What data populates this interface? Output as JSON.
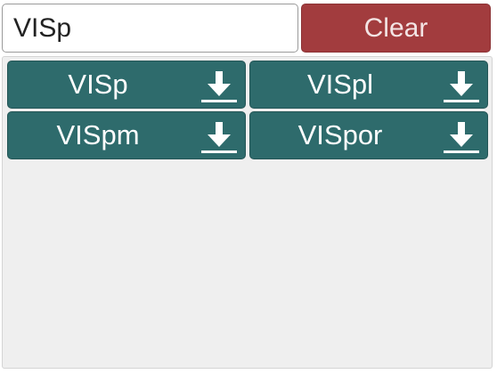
{
  "search": {
    "value": "VISp",
    "placeholder": ""
  },
  "clear_button": {
    "label": "Clear",
    "color": "#a23c3e"
  },
  "results": {
    "items": [
      {
        "label": "VISp",
        "icon": "download-icon"
      },
      {
        "label": "VISpl",
        "icon": "download-icon"
      },
      {
        "label": "VISpm",
        "icon": "download-icon"
      },
      {
        "label": "VISpor",
        "icon": "download-icon"
      }
    ],
    "item_color": "#2e6b6c",
    "panel_color": "#efefef"
  }
}
